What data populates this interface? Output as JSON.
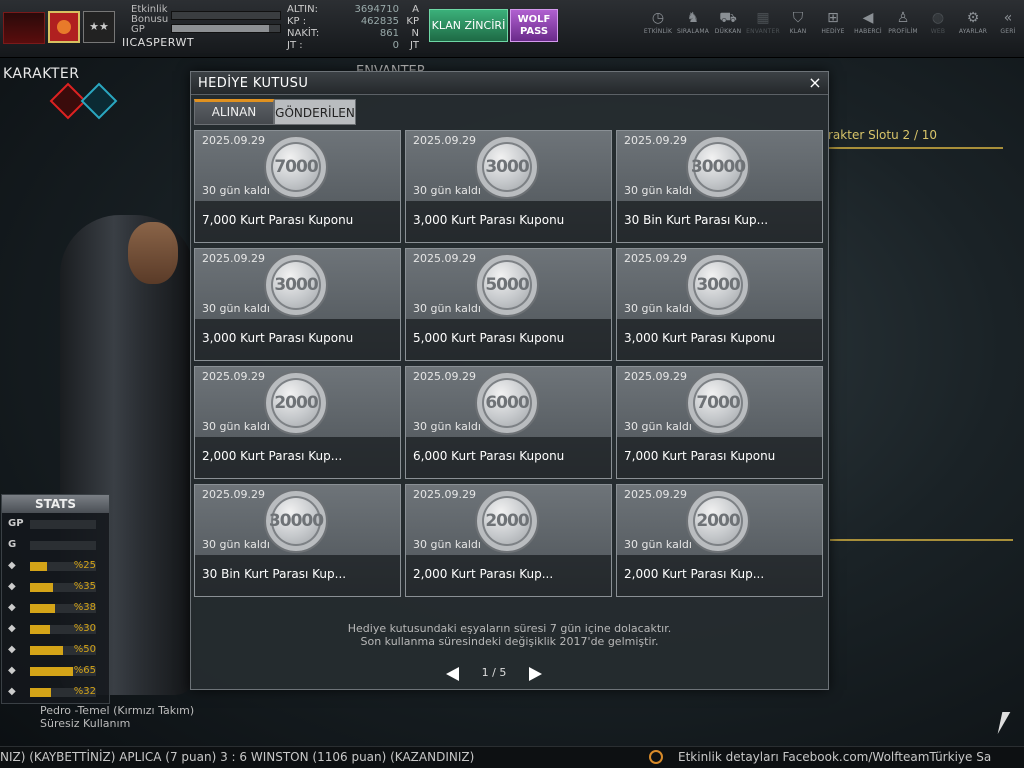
{
  "topbar": {
    "etkinlik_label": "Etkinlik Bonusu",
    "etkinlik_bonus_fill": 0,
    "gp_label": "GP",
    "gp_fill": 0.9,
    "username": "IICASPERWT",
    "currency": [
      {
        "label": "ALTIN:",
        "value": "3694710",
        "unit": "A"
      },
      {
        "label": "KP :",
        "value": "462835",
        "unit": "KP"
      },
      {
        "label": "NAKİT:",
        "value": "861",
        "unit": "N"
      },
      {
        "label": "JT :",
        "value": "0",
        "unit": "JT"
      }
    ],
    "klan_button": "KLAN ZİNCİRİ",
    "wolf_button": "WOLF PASS",
    "nav": [
      {
        "label": "ETKİNLİK",
        "icon": "clock-icon",
        "glyph": "◷"
      },
      {
        "label": "SIRALAMA",
        "icon": "wolf-rank-icon",
        "glyph": "♞"
      },
      {
        "label": "DÜKKAN",
        "icon": "cart-icon",
        "glyph": "⛟"
      },
      {
        "label": "ENVANTER",
        "icon": "inventory-icon",
        "glyph": "▦"
      },
      {
        "label": "KLAN",
        "icon": "shield-icon",
        "glyph": "⛉"
      },
      {
        "label": "HEDİYE",
        "icon": "gift-icon",
        "glyph": "⊞"
      },
      {
        "label": "HABERCİ",
        "icon": "megaphone-icon",
        "glyph": "◀"
      },
      {
        "label": "PROFİLİM",
        "icon": "profile-icon",
        "glyph": "♙"
      },
      {
        "label": "WEB",
        "icon": "globe-icon",
        "glyph": "◍"
      },
      {
        "label": "AYARLAR",
        "icon": "gear-icon",
        "glyph": "⚙"
      },
      {
        "label": "GERİ",
        "icon": "back-icon",
        "glyph": "«"
      }
    ]
  },
  "background": {
    "karakter_title": "KARAKTER",
    "envanter_title": "ENVANTER",
    "slot_label": "rakter Slotu 2 / 10"
  },
  "stats": {
    "title": "STATS",
    "rows": [
      {
        "label": "GP",
        "icon": "gp-icon",
        "value": "",
        "fill": 0
      },
      {
        "label": "G",
        "icon": "g-icon",
        "value": "",
        "fill": 0
      },
      {
        "label": "",
        "icon": "helmet-icon",
        "value": "%25",
        "fill": 0.25
      },
      {
        "label": "",
        "icon": "vest-icon",
        "value": "%35",
        "fill": 0.35
      },
      {
        "label": "",
        "icon": "glove-icon",
        "value": "%38",
        "fill": 0.38
      },
      {
        "label": "",
        "icon": "boot-icon",
        "value": "%30",
        "fill": 0.3
      },
      {
        "label": "",
        "icon": "heart-icon",
        "value": "%50",
        "fill": 0.5
      },
      {
        "label": "",
        "icon": "burst-icon",
        "value": "%65",
        "fill": 0.65
      },
      {
        "label": "",
        "icon": "speed-icon",
        "value": "%32",
        "fill": 0.32
      }
    ],
    "char_name": "Pedro -Temel (Kırmızı Takım)",
    "char_sub": "Süresiz Kullanım"
  },
  "modal": {
    "title": "HEDİYE KUTUSU",
    "close_label": "×",
    "tabs": [
      {
        "label": "ALINAN",
        "active": true
      },
      {
        "label": "GÖNDERİLEN",
        "active": false
      }
    ],
    "items": [
      {
        "date": "2025.09.29",
        "coin": "7000",
        "days": "30 gün kaldı",
        "title": "7,000 Kurt Parası Kuponu"
      },
      {
        "date": "2025.09.29",
        "coin": "3000",
        "days": "30 gün kaldı",
        "title": "3,000 Kurt Parası Kuponu"
      },
      {
        "date": "2025.09.29",
        "coin": "30000",
        "days": "30 gün kaldı",
        "title": "30 Bin Kurt Parası Kup..."
      },
      {
        "date": "2025.09.29",
        "coin": "3000",
        "days": "30 gün kaldı",
        "title": "3,000 Kurt Parası Kuponu"
      },
      {
        "date": "2025.09.29",
        "coin": "5000",
        "days": "30 gün kaldı",
        "title": "5,000 Kurt Parası Kuponu"
      },
      {
        "date": "2025.09.29",
        "coin": "3000",
        "days": "30 gün kaldı",
        "title": "3,000 Kurt Parası Kuponu"
      },
      {
        "date": "2025.09.29",
        "coin": "2000",
        "days": "30 gün kaldı",
        "title": "2,000  Kurt Parası Kup..."
      },
      {
        "date": "2025.09.29",
        "coin": "6000",
        "days": "30 gün kaldı",
        "title": "6,000 Kurt Parası Kuponu"
      },
      {
        "date": "2025.09.29",
        "coin": "7000",
        "days": "30 gün kaldı",
        "title": "7,000 Kurt Parası Kuponu"
      },
      {
        "date": "2025.09.29",
        "coin": "30000",
        "days": "30 gün kaldı",
        "title": "30 Bin Kurt Parası Kup..."
      },
      {
        "date": "2025.09.29",
        "coin": "2000",
        "days": "30 gün kaldı",
        "title": "2,000  Kurt Parası Kup..."
      },
      {
        "date": "2025.09.29",
        "coin": "2000",
        "days": "30 gün kaldı",
        "title": "2,000  Kurt Parası Kup..."
      }
    ],
    "notice_line1": "Hediye kutusundaki eşyaların süresi 7 gün içine dolacaktır.",
    "notice_line2": "Son kullanma süresindeki değişiklik 2017'de gelmiştir.",
    "page_indicator": "1 / 5"
  },
  "ticker": {
    "left_text": "NIZ)     (KAYBETTİNİZ) APLICA (7 puan) 3 : 6 WINSTON (1106 puan) (KAZANDINIZ)",
    "right_text": "Etkinlik detayları Facebook.com/WolfteamTürkiye Sa"
  },
  "colors": {
    "accent_tab": "#e09120",
    "stat_fill": "#d4a418",
    "gold_line": "#a88f3a"
  }
}
